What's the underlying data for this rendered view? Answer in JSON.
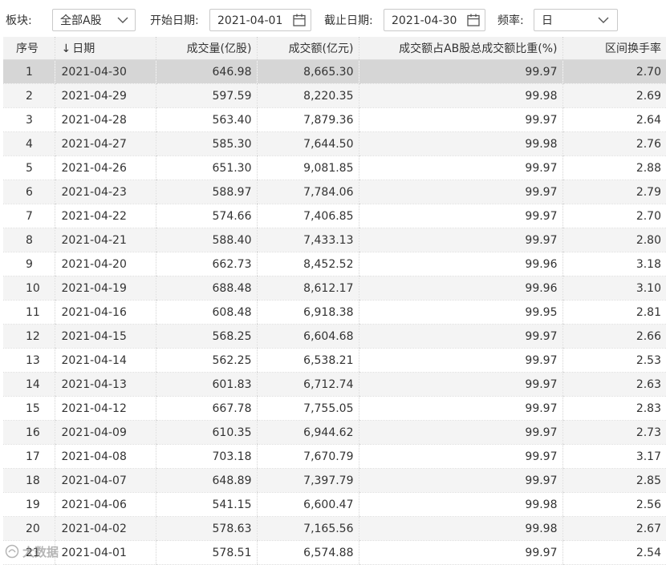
{
  "toolbar": {
    "sector_label": "板块:",
    "sector_value": "全部A股",
    "start_label": "开始日期:",
    "start_value": "2021-04-01",
    "end_label": "截止日期:",
    "end_value": "2021-04-30",
    "freq_label": "频率:",
    "freq_value": "日"
  },
  "table": {
    "headers": [
      "序号",
      "日期",
      "成交量(亿股)",
      "成交额(亿元)",
      "成交额占AB股总成交额比重(%)",
      "区间换手率"
    ],
    "sort_arrow": "↓",
    "rows": [
      [
        "1",
        "2021-04-30",
        "646.98",
        "8,665.30",
        "99.97",
        "2.70"
      ],
      [
        "2",
        "2021-04-29",
        "597.59",
        "8,220.35",
        "99.98",
        "2.69"
      ],
      [
        "3",
        "2021-04-28",
        "563.40",
        "7,879.36",
        "99.97",
        "2.64"
      ],
      [
        "4",
        "2021-04-27",
        "585.30",
        "7,644.50",
        "99.98",
        "2.76"
      ],
      [
        "5",
        "2021-04-26",
        "651.30",
        "9,081.85",
        "99.97",
        "2.88"
      ],
      [
        "6",
        "2021-04-23",
        "588.97",
        "7,784.06",
        "99.97",
        "2.79"
      ],
      [
        "7",
        "2021-04-22",
        "574.66",
        "7,406.85",
        "99.97",
        "2.70"
      ],
      [
        "8",
        "2021-04-21",
        "588.40",
        "7,433.13",
        "99.97",
        "2.80"
      ],
      [
        "9",
        "2021-04-20",
        "662.73",
        "8,452.52",
        "99.96",
        "3.18"
      ],
      [
        "10",
        "2021-04-19",
        "688.48",
        "8,612.17",
        "99.96",
        "3.10"
      ],
      [
        "11",
        "2021-04-16",
        "608.48",
        "6,918.38",
        "99.95",
        "2.81"
      ],
      [
        "12",
        "2021-04-15",
        "568.25",
        "6,604.68",
        "99.97",
        "2.66"
      ],
      [
        "13",
        "2021-04-14",
        "562.25",
        "6,538.21",
        "99.97",
        "2.53"
      ],
      [
        "14",
        "2021-04-13",
        "601.83",
        "6,712.74",
        "99.97",
        "2.63"
      ],
      [
        "15",
        "2021-04-12",
        "667.78",
        "7,755.05",
        "99.97",
        "2.83"
      ],
      [
        "16",
        "2021-04-09",
        "610.35",
        "6,944.62",
        "99.97",
        "2.73"
      ],
      [
        "17",
        "2021-04-08",
        "703.18",
        "7,670.79",
        "99.97",
        "3.17"
      ],
      [
        "18",
        "2021-04-07",
        "648.89",
        "7,397.79",
        "99.97",
        "2.85"
      ],
      [
        "19",
        "2021-04-06",
        "541.15",
        "6,600.47",
        "99.98",
        "2.56"
      ],
      [
        "20",
        "2021-04-02",
        "578.63",
        "7,165.56",
        "99.98",
        "2.67"
      ],
      [
        "21",
        "2021-04-01",
        "578.51",
        "6,574.88",
        "99.97",
        "2.54"
      ]
    ]
  },
  "watermark": "大数据",
  "icons": {
    "sector_dropdown": "chevron-down-icon",
    "start_calendar": "calendar-icon",
    "end_calendar": "calendar-icon",
    "freq_dropdown": "chevron-down-icon"
  },
  "colors": {
    "header_bg": "#f2f2f2",
    "alt_row_bg": "#f4f4f4",
    "selected_row_bg": "#d6d6d6",
    "border": "#c9c9c9"
  }
}
